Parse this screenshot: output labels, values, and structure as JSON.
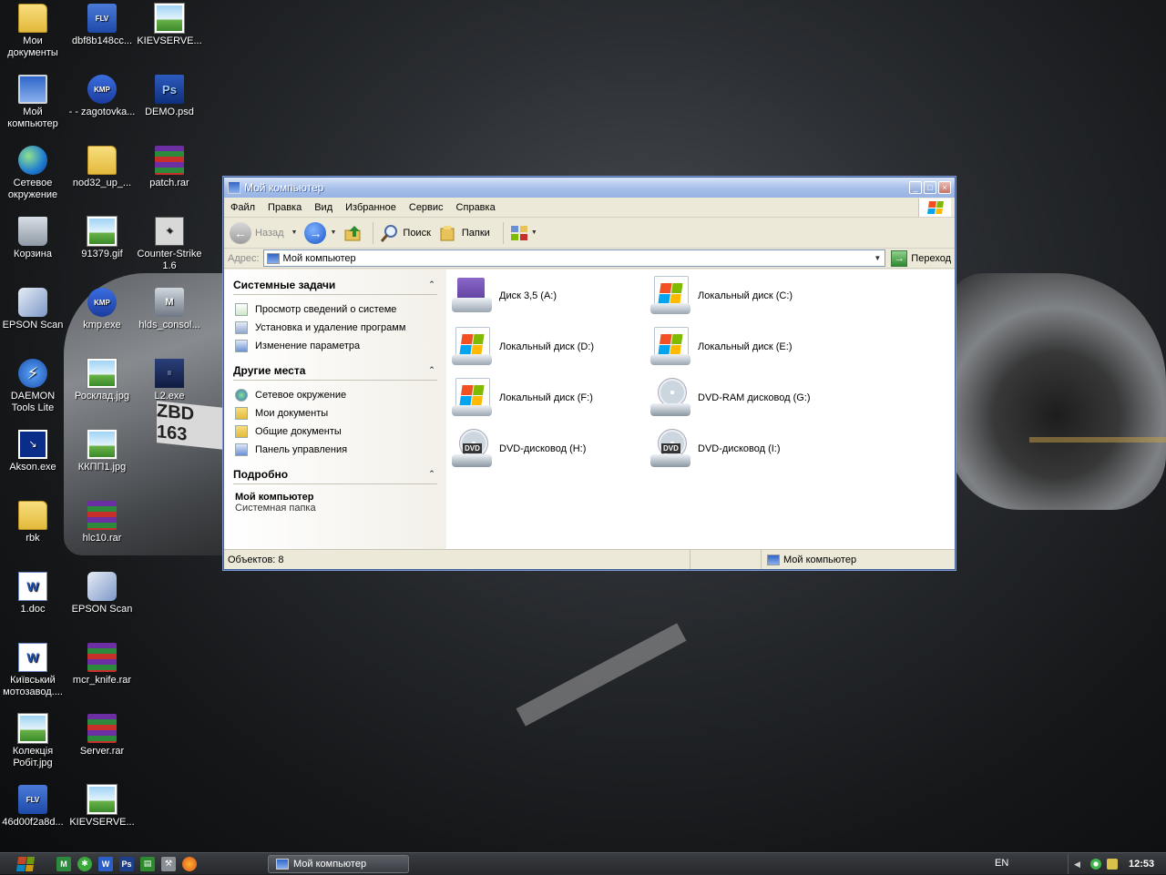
{
  "wallpaper": {
    "plate_text": "ZBD 163"
  },
  "desktop_icons": [
    {
      "label": "Мои документы",
      "icon": "folder-icon"
    },
    {
      "label": "dbf8b148cc...",
      "icon": "flv-file-icon",
      "badge": "FLV"
    },
    {
      "label": "KIEVSERVE...",
      "icon": "image-file-icon"
    },
    {
      "label": "Мой компьютер",
      "icon": "computer-icon"
    },
    {
      "label": "- - zagotovka...",
      "icon": "kmp-file-icon",
      "badge": "KMP"
    },
    {
      "label": "DEMO.psd",
      "icon": "psd-file-icon",
      "badge": "Ps"
    },
    {
      "label": "Сетевое окружение",
      "icon": "network-icon"
    },
    {
      "label": "nod32_up_...",
      "icon": "folder-icon"
    },
    {
      "label": "patch.rar",
      "icon": "rar-archive-icon"
    },
    {
      "label": "Корзина",
      "icon": "recycle-bin-icon"
    },
    {
      "label": "91379.gif",
      "icon": "image-file-icon"
    },
    {
      "label": "Counter-Strike 1.6",
      "icon": "counter-strike-icon"
    },
    {
      "label": "EPSON Scan",
      "icon": "epson-scan-icon"
    },
    {
      "label": "kmp.exe",
      "icon": "kmp-file-icon",
      "badge": "KMP"
    },
    {
      "label": "hlds_consol...",
      "icon": "hlds-icon"
    },
    {
      "label": "DAEMON Tools Lite",
      "icon": "daemon-tools-icon"
    },
    {
      "label": "Росклад.jpg",
      "icon": "image-file-icon"
    },
    {
      "label": "L2.exe",
      "icon": "lineage-icon"
    },
    {
      "label": "Akson.exe",
      "icon": "akson-icon"
    },
    {
      "label": "ККПП1.jpg",
      "icon": "image-file-icon"
    },
    {
      "label": "rbk",
      "icon": "folder-icon"
    },
    {
      "label": "hlc10.rar",
      "icon": "rar-archive-icon"
    },
    {
      "label": "1.doc",
      "icon": "word-doc-icon"
    },
    {
      "label": "EPSON Scan",
      "icon": "epson-scan-icon"
    },
    {
      "label": "Київський мотозавод....",
      "icon": "word-doc-icon"
    },
    {
      "label": "mcr_knife.rar",
      "icon": "rar-archive-icon"
    },
    {
      "label": "Колекція Робіт.jpg",
      "icon": "image-file-icon"
    },
    {
      "label": "Server.rar",
      "icon": "rar-archive-icon"
    },
    {
      "label": "46d00f2a8d...",
      "icon": "flv-file-icon",
      "badge": "FLV"
    },
    {
      "label": "KIEVSERVE...",
      "icon": "image-file-icon"
    }
  ],
  "window": {
    "title": "Мой компьютер",
    "menu": [
      "Файл",
      "Правка",
      "Вид",
      "Избранное",
      "Сервис",
      "Справка"
    ],
    "toolbar": {
      "back": "Назад",
      "search": "Поиск",
      "folders": "Папки"
    },
    "address": {
      "label": "Адрес:",
      "value": "Мой компьютер",
      "go": "Переход"
    },
    "taskpane": {
      "system_tasks": {
        "title": "Системные задачи",
        "items": [
          "Просмотр сведений о системе",
          "Установка и удаление программ",
          "Изменение параметра"
        ]
      },
      "other_places": {
        "title": "Другие места",
        "items": [
          "Сетевое окружение",
          "Мои документы",
          "Общие документы",
          "Панель управления"
        ]
      },
      "details": {
        "title": "Подробно",
        "name": "Мой компьютер",
        "type": "Системная папка"
      }
    },
    "drives": [
      {
        "label": "Диск 3,5 (A:)",
        "kind": "floppy"
      },
      {
        "label": "Локальный диск (C:)",
        "kind": "hdd"
      },
      {
        "label": "Локальный диск (D:)",
        "kind": "hdd"
      },
      {
        "label": "Локальный диск (E:)",
        "kind": "hdd"
      },
      {
        "label": "Локальный диск (F:)",
        "kind": "hdd"
      },
      {
        "label": "DVD-RAM дисковод (G:)",
        "kind": "cd"
      },
      {
        "label": "DVD-дисковод (H:)",
        "kind": "dvd"
      },
      {
        "label": "DVD-дисковод (I:)",
        "kind": "dvd"
      }
    ],
    "dvd_badge": "DVD",
    "status": {
      "objects": "Объектов: 8",
      "location": "Мой компьютер"
    }
  },
  "taskbar": {
    "task_button": "Мой компьютер",
    "quick_launch": [
      "ql-icon-1",
      "ql-icon-2",
      "word-icon",
      "photoshop-icon",
      "excel-icon",
      "tools-icon",
      "firefox-icon"
    ],
    "language": "EN",
    "clock": "12:53"
  },
  "colors": {
    "flag_red": "#f25022",
    "flag_green": "#7fba00",
    "flag_blue": "#00a4ef",
    "flag_yellow": "#ffb900"
  }
}
